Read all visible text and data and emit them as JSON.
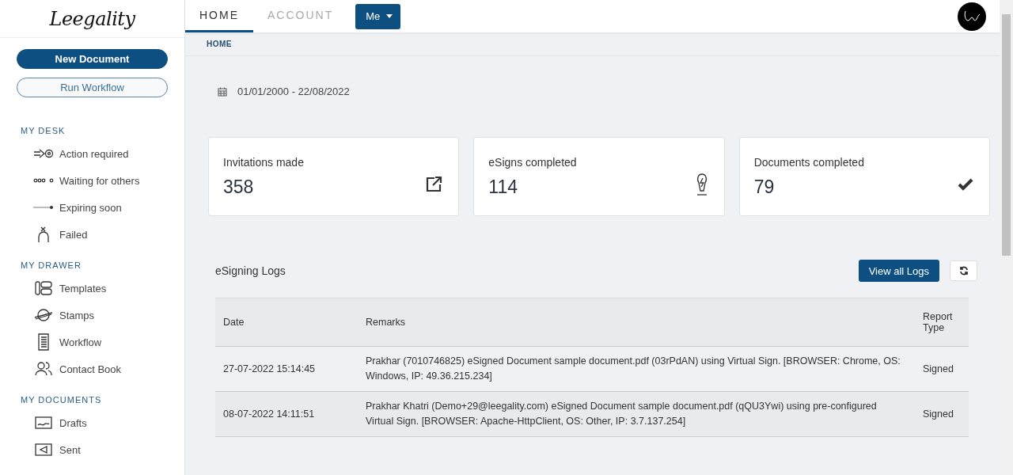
{
  "logo": {
    "text": "Leegality"
  },
  "sidebar": {
    "buttons": [
      {
        "label": "New Document",
        "kind": "primary"
      },
      {
        "label": "Run Workflow",
        "kind": "outline"
      }
    ],
    "sections": [
      {
        "title": "MY DESK",
        "items": [
          {
            "label": "Action required"
          },
          {
            "label": "Waiting for others"
          },
          {
            "label": "Expiring soon"
          },
          {
            "label": "Failed"
          }
        ]
      },
      {
        "title": "MY DRAWER",
        "items": [
          {
            "label": "Templates"
          },
          {
            "label": "Stamps"
          },
          {
            "label": "Workflow"
          },
          {
            "label": "Contact Book"
          }
        ]
      },
      {
        "title": "MY DOCUMENTS",
        "items": [
          {
            "label": "Drafts"
          },
          {
            "label": "Sent"
          }
        ]
      }
    ]
  },
  "tabs": [
    {
      "label": "HOME",
      "selected": true
    },
    {
      "label": "ACCOUNT",
      "selected": false
    }
  ],
  "user_menu": {
    "label": "Me"
  },
  "breadcrumb": "HOME",
  "date_range": "01/01/2000 - 22/08/2022",
  "stats": [
    {
      "label": "Invitations made",
      "value": "358"
    },
    {
      "label": "eSigns completed",
      "value": "114"
    },
    {
      "label": "Documents completed",
      "value": "79"
    }
  ],
  "logs": {
    "title": "eSigning Logs",
    "view_all": "View all Logs",
    "columns": [
      "Date",
      "Remarks",
      "Report Type"
    ],
    "rows": [
      [
        "27-07-2022 15:14:45",
        "Prakhar (7010746825) eSigned Document sample document.pdf (03rPdAN) using Virtual Sign. [BROWSER: Chrome, OS: Windows, IP: 49.36.215.234]",
        "Signed"
      ],
      [
        "08-07-2022 14:11:51",
        "Prakhar Khatri (Demo+29@leegality.com) eSigned Document sample document.pdf (qQU3Ywi) using pre-configured Virtual Sign. [BROWSER: Apache-HttpClient, OS: Other, IP: 3.7.137.254]",
        "Signed"
      ]
    ]
  }
}
